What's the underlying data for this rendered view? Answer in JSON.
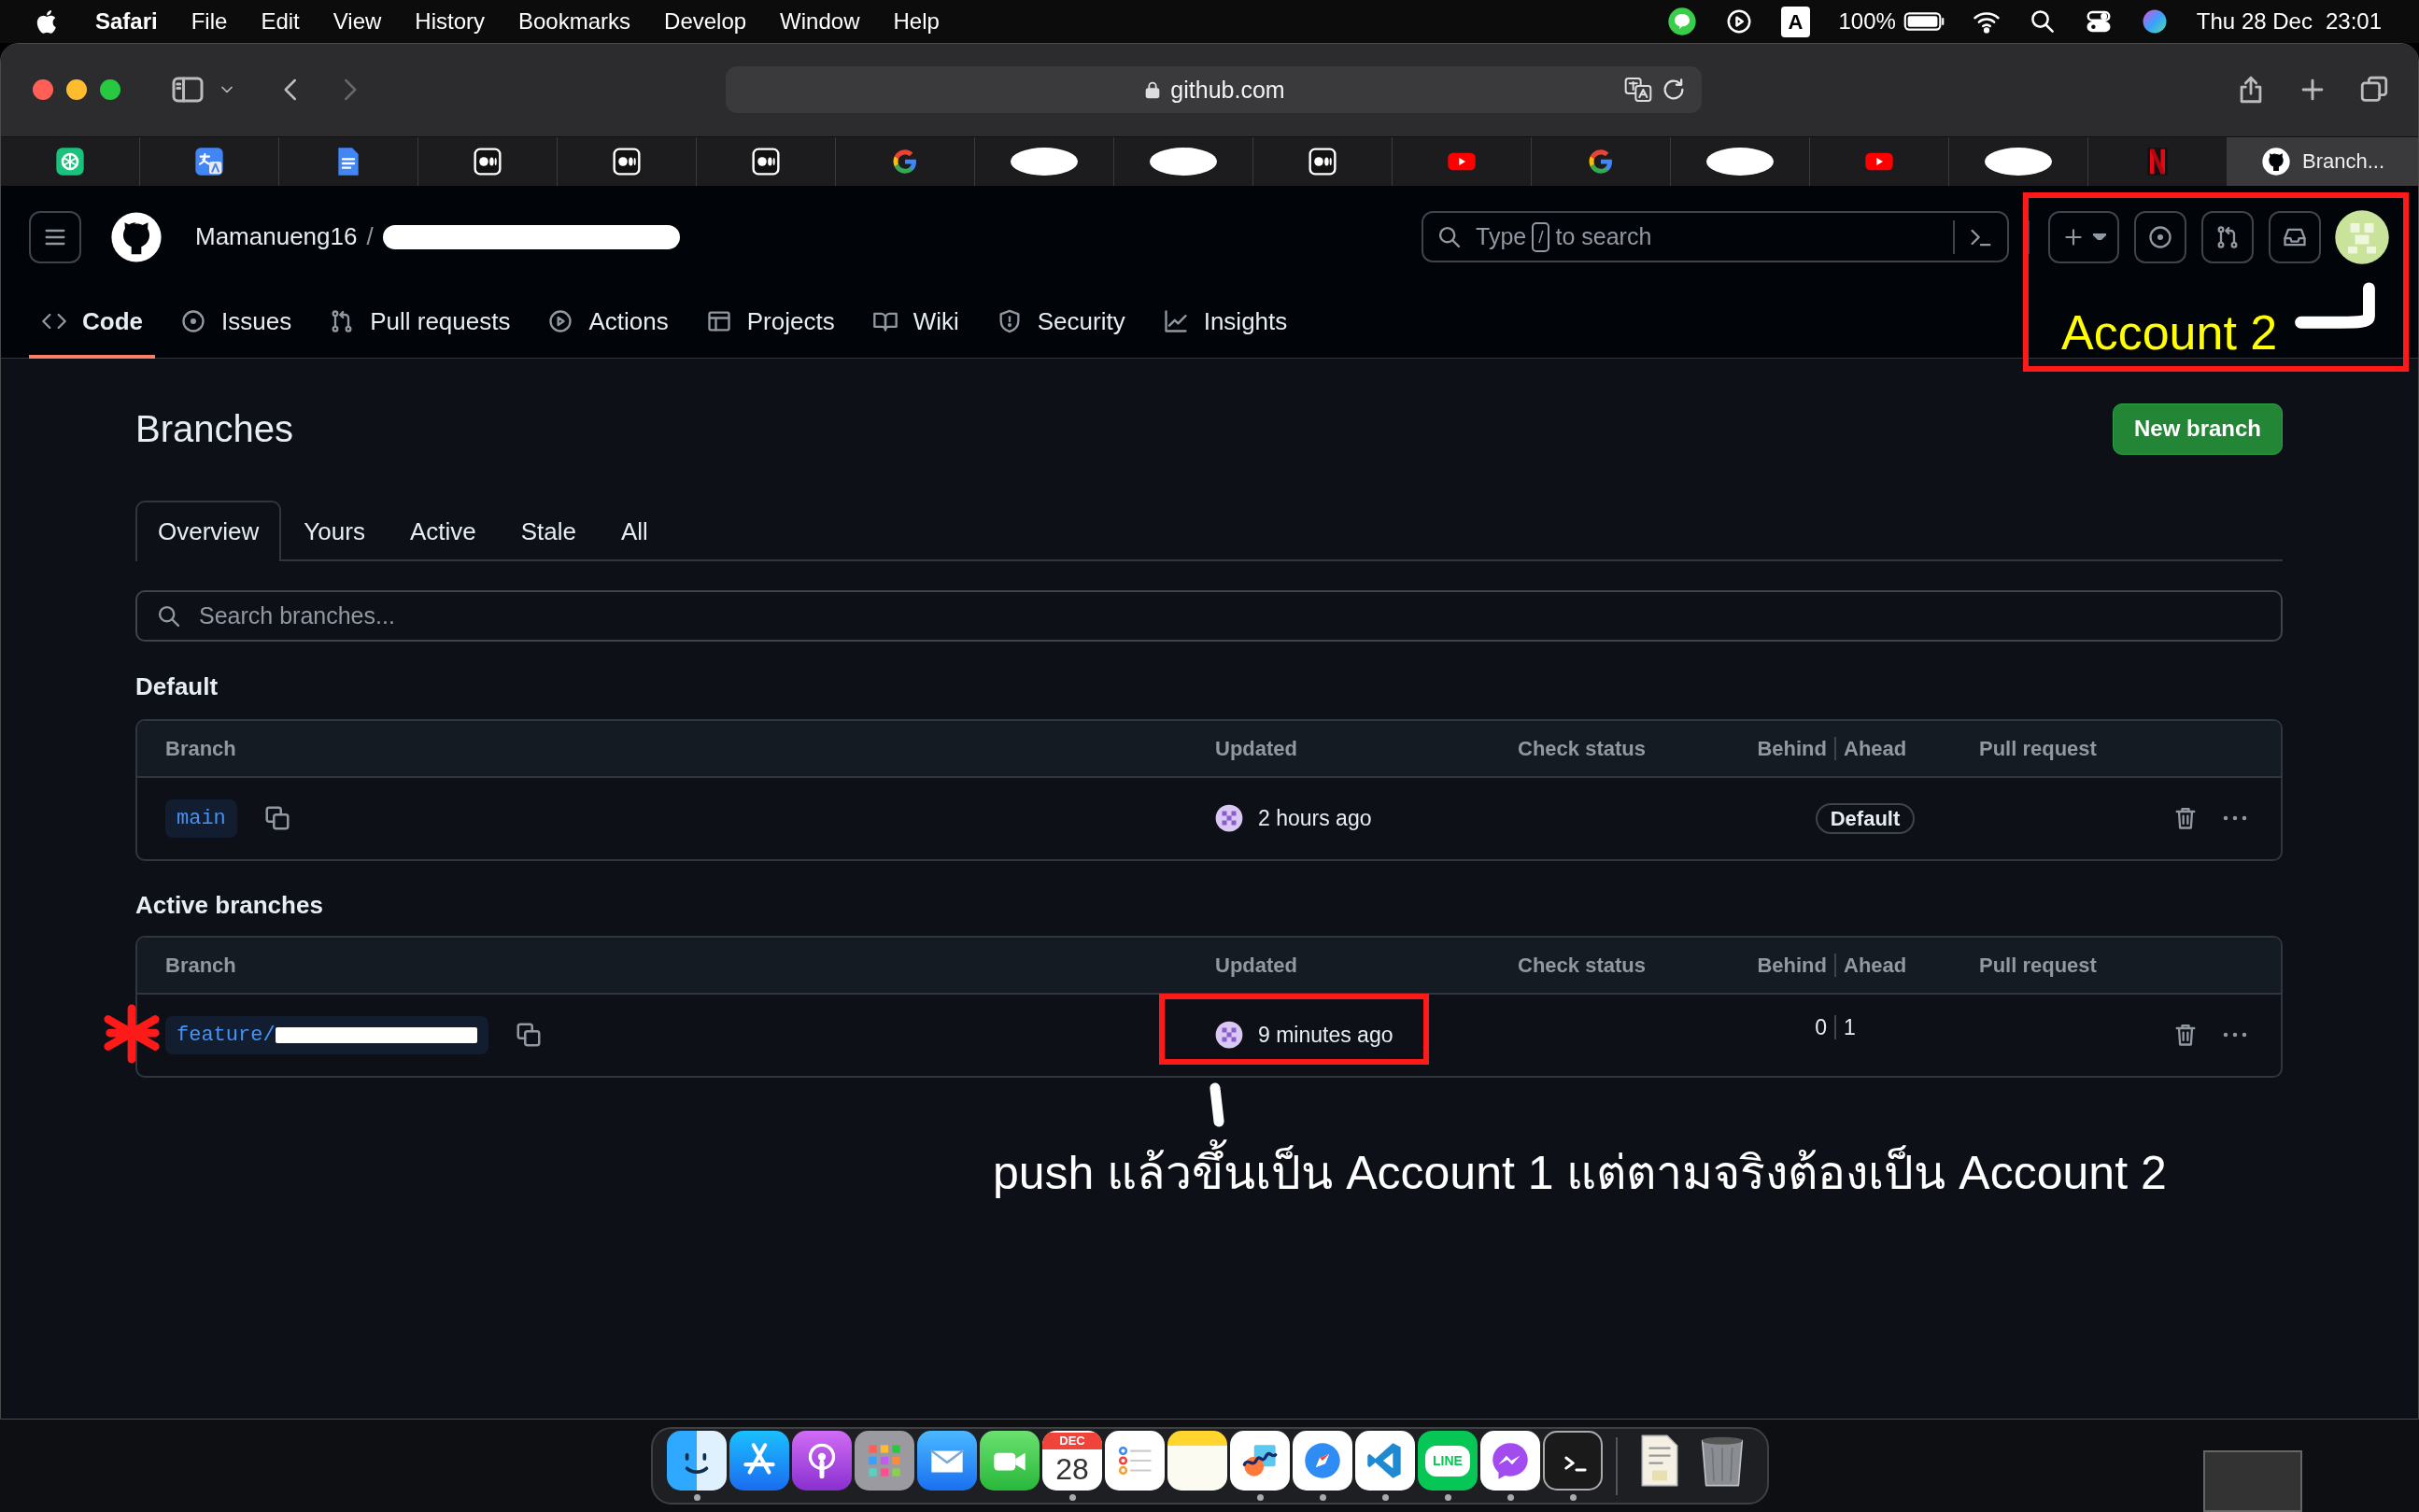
{
  "menu_bar": {
    "app_name": "Safari",
    "menus": [
      "File",
      "Edit",
      "View",
      "History",
      "Bookmarks",
      "Develop",
      "Window",
      "Help"
    ],
    "input_source": "A",
    "battery": "100%",
    "date": "Thu 28 Dec",
    "time": "23:01"
  },
  "browser": {
    "address": "github.com",
    "tabs": [
      {
        "kind": "chatgpt",
        "selected": false
      },
      {
        "kind": "translate",
        "selected": false
      },
      {
        "kind": "docs",
        "selected": false
      },
      {
        "kind": "medium",
        "selected": false
      },
      {
        "kind": "medium",
        "selected": false
      },
      {
        "kind": "medium",
        "selected": false
      },
      {
        "kind": "google",
        "selected": false
      },
      {
        "kind": "redacted",
        "selected": false
      },
      {
        "kind": "redacted",
        "selected": false
      },
      {
        "kind": "medium",
        "selected": false
      },
      {
        "kind": "youtube",
        "selected": false
      },
      {
        "kind": "google",
        "selected": false
      },
      {
        "kind": "redacted",
        "selected": false
      },
      {
        "kind": "youtube",
        "selected": false
      },
      {
        "kind": "redacted",
        "selected": false
      },
      {
        "kind": "netflix",
        "selected": false
      },
      {
        "kind": "github",
        "label": "Branch...",
        "selected": true
      }
    ]
  },
  "repo_header": {
    "owner": "Mamanueng16",
    "separator": "/",
    "repo_redacted": true,
    "search": {
      "before": "Type",
      "key": "/",
      "after": "to search"
    },
    "nav": [
      {
        "kind": "code",
        "label": "Code",
        "selected": true
      },
      {
        "kind": "issues",
        "label": "Issues",
        "selected": false
      },
      {
        "kind": "pulls",
        "label": "Pull requests",
        "selected": false
      },
      {
        "kind": "actions",
        "label": "Actions",
        "selected": false
      },
      {
        "kind": "projects",
        "label": "Projects",
        "selected": false
      },
      {
        "kind": "wiki",
        "label": "Wiki",
        "selected": false
      },
      {
        "kind": "security",
        "label": "Security",
        "selected": false
      },
      {
        "kind": "insights",
        "label": "Insights",
        "selected": false
      }
    ]
  },
  "page": {
    "title": "Branches",
    "new_button": "New branch",
    "filters": [
      {
        "label": "Overview",
        "selected": true
      },
      {
        "label": "Yours",
        "selected": false
      },
      {
        "label": "Active",
        "selected": false
      },
      {
        "label": "Stale",
        "selected": false
      },
      {
        "label": "All",
        "selected": false
      }
    ],
    "search_placeholder": "Search branches...",
    "sections": [
      {
        "heading": "Default",
        "columns": [
          "Branch",
          "Updated",
          "Check status",
          "Behind",
          "Ahead",
          "Pull request"
        ],
        "rows": [
          {
            "branch": "main",
            "redacted": false,
            "updated": "2 hours ago",
            "badge": "Default"
          }
        ]
      },
      {
        "heading": "Active branches",
        "columns": [
          "Branch",
          "Updated",
          "Check status",
          "Behind",
          "Ahead",
          "Pull request"
        ],
        "rows": [
          {
            "branch": "feature/",
            "redacted": true,
            "updated": "9 minutes ago",
            "behind": "0",
            "ahead": "1"
          }
        ]
      }
    ]
  },
  "annotations": {
    "account_label": "Account 2",
    "note": "push แล้วขึ้นเป็น Account 1 แต่ตามจริงต้องเป็น Account 2"
  },
  "dock": {
    "apps": [
      {
        "kind": "finder",
        "running": true
      },
      {
        "kind": "appstore",
        "running": false
      },
      {
        "kind": "podcasts",
        "running": false
      },
      {
        "kind": "launchpad",
        "running": false
      },
      {
        "kind": "mail",
        "running": false
      },
      {
        "kind": "facetime",
        "running": false
      },
      {
        "kind": "calendar",
        "running": true,
        "month": "DEC",
        "day": "28"
      },
      {
        "kind": "reminders",
        "running": false
      },
      {
        "kind": "notes",
        "running": false
      },
      {
        "kind": "freeform",
        "running": true
      },
      {
        "kind": "safari",
        "running": true
      },
      {
        "kind": "vscode",
        "running": true
      },
      {
        "kind": "line",
        "running": true,
        "label": "LINE"
      },
      {
        "kind": "messenger",
        "running": true
      },
      {
        "kind": "terminal",
        "running": true
      }
    ],
    "others": [
      {
        "kind": "document"
      },
      {
        "kind": "trash"
      }
    ]
  }
}
